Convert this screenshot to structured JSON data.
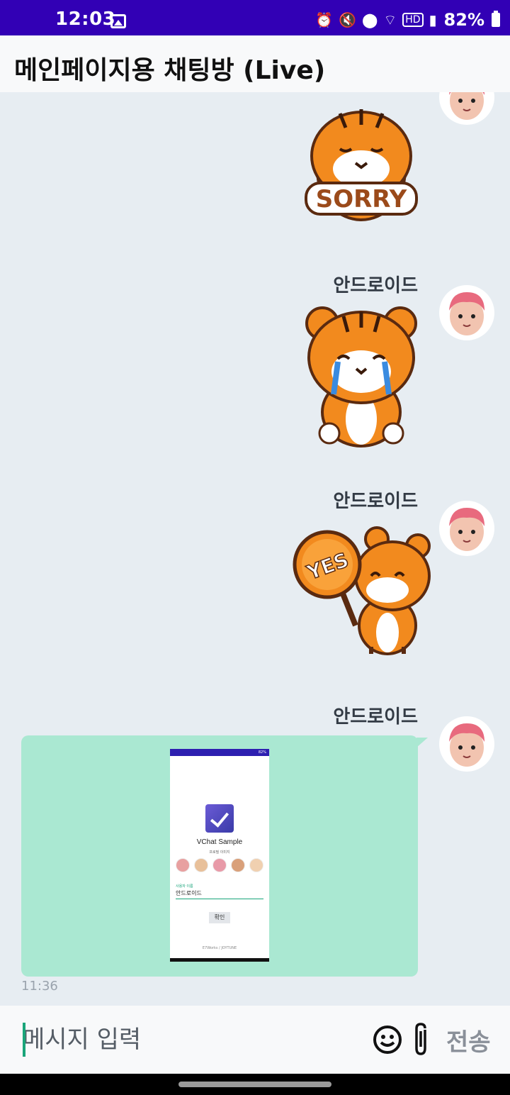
{
  "status_bar": {
    "time": "12:03",
    "icons": [
      "gallery-icon",
      "alarm-icon",
      "mute-icon",
      "location-icon",
      "wifi-icon",
      "hd-icon",
      "signal-icon"
    ],
    "battery": "82%",
    "hd_label": "HD"
  },
  "app_bar": {
    "title": "메인페이지용 채팅방 (Live)"
  },
  "messages": [
    {
      "sender": "",
      "type": "sticker",
      "sticker_text": "SORRY",
      "avatar": "avatar-icon"
    },
    {
      "sender": "안드로이드",
      "type": "sticker",
      "sticker_text": "",
      "avatar": "avatar-icon"
    },
    {
      "sender": "안드로이드",
      "type": "sticker",
      "sticker_text": "YES",
      "avatar": "avatar-icon"
    },
    {
      "sender": "안드로이드",
      "type": "image",
      "time": "11:36",
      "avatar": "avatar-icon",
      "screenshot": {
        "status": "82%",
        "title": "VChat Sample",
        "subtitle": "프로필 이미지",
        "field_label": "사용자 이름",
        "field_value": "안드로이드",
        "button": "확인",
        "footer": "E7Works / JOYTUNE"
      }
    }
  ],
  "input_bar": {
    "placeholder": "메시지 입력",
    "send_label": "전송"
  },
  "colors": {
    "status_bar": "#3200b5",
    "chat_bg": "#e7edf2",
    "bubble": "#aae8d2",
    "accent": "#1aa57a"
  }
}
